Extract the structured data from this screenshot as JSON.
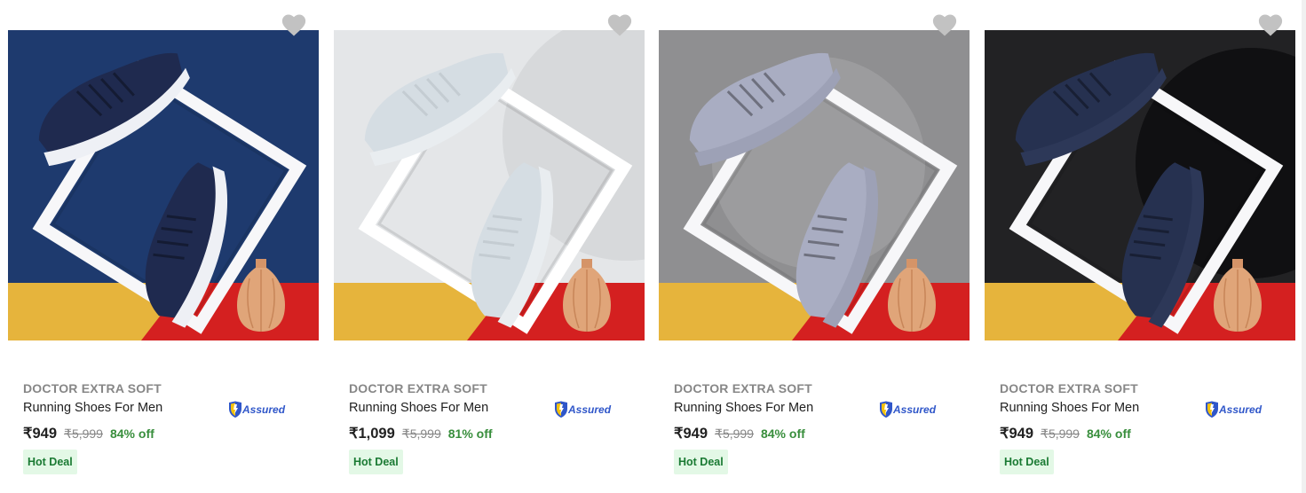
{
  "products": [
    {
      "brand": "DOCTOR EXTRA SOFT",
      "title": "Running Shoes For Men",
      "price": "₹949",
      "mrp": "₹5,999",
      "discount": "84% off",
      "badge": "Hot Deal",
      "assured": "Assured",
      "bg_color": "#1e3a6e",
      "shoe_color": "#1f2a4f",
      "sole_color": "#eef0f5"
    },
    {
      "brand": "DOCTOR EXTRA SOFT",
      "title": "Running Shoes For Men",
      "price": "₹1,099",
      "mrp": "₹5,999",
      "discount": "81% off",
      "badge": "Hot Deal",
      "assured": "Assured",
      "bg_color": "#e4e6e8",
      "shoe_color": "#d5dde3",
      "sole_color": "#e9edf0"
    },
    {
      "brand": "DOCTOR EXTRA SOFT",
      "title": "Running Shoes For Men",
      "price": "₹949",
      "mrp": "₹5,999",
      "discount": "84% off",
      "badge": "Hot Deal",
      "assured": "Assured",
      "bg_color": "#8f8f91",
      "shoe_color": "#a9adc2",
      "sole_color": "#9da1b6"
    },
    {
      "brand": "DOCTOR EXTRA SOFT",
      "title": "Running Shoes For Men",
      "price": "₹949",
      "mrp": "₹5,999",
      "discount": "84% off",
      "badge": "Hot Deal",
      "assured": "Assured",
      "bg_color": "#222224",
      "shoe_color": "#263150",
      "sole_color": "#2d3858"
    }
  ],
  "icons": {
    "wishlist": "heart-icon",
    "assured": "assured-shield-icon"
  },
  "colors": {
    "heart": "#c2c2c2",
    "discount": "#388e3c",
    "deal_bg": "#e3f8e6",
    "assured_blue": "#2f56c9",
    "assured_gold": "#f4c20d",
    "floor_red": "#d42020",
    "floor_yellow": "#e6b43c"
  }
}
